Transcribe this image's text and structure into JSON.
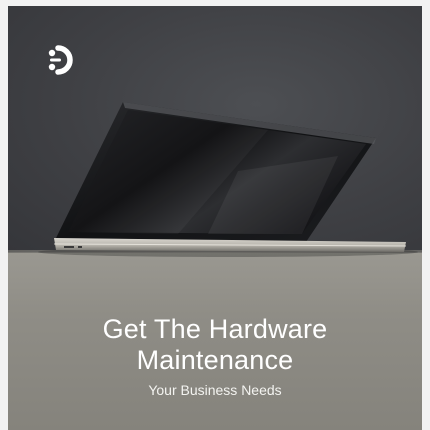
{
  "brand": {
    "logo_icon": "brand-logo-icon",
    "logo_color": "#ffffff"
  },
  "headline": {
    "line1": "Get The Hardware",
    "line2": "Maintenance"
  },
  "subheadline": "Your Business Needs",
  "colors": {
    "wall": "#3f4044",
    "desk": "#8f8d86",
    "text": "#ffffff"
  }
}
